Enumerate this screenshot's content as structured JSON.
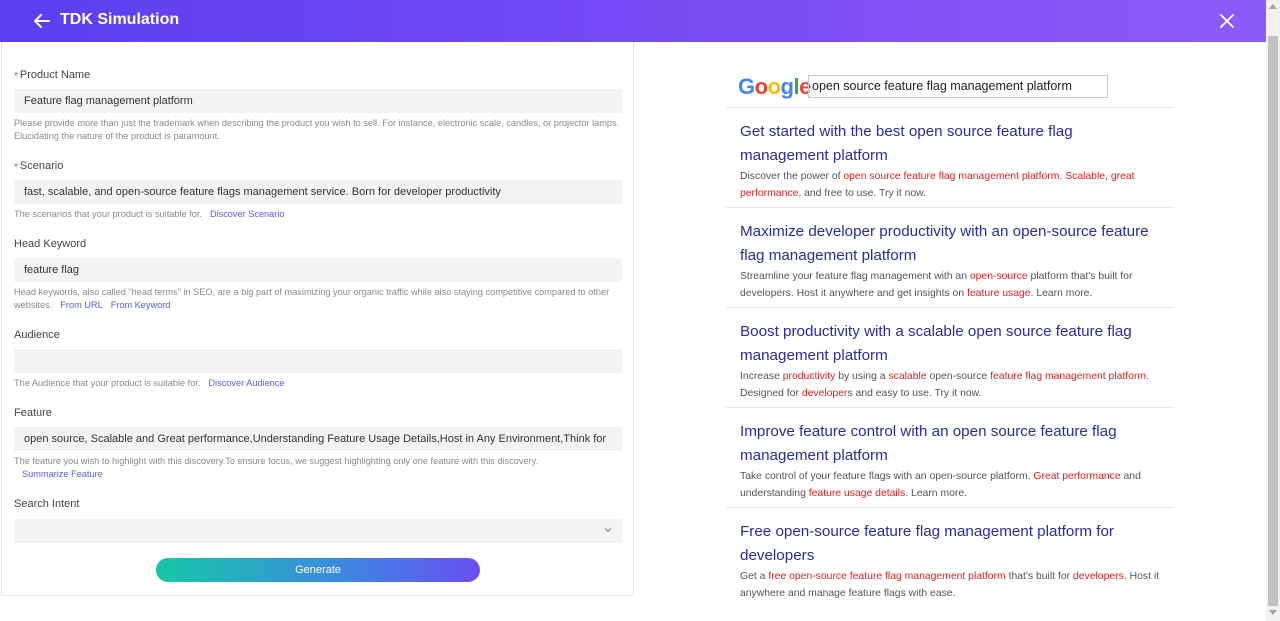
{
  "header": {
    "title": "TDK Simulation",
    "back_icon": "arrow-left-icon",
    "close_icon": "close-icon",
    "background_colors": [
      "#5b3ff0",
      "#8c5cf7"
    ]
  },
  "form": {
    "product_name": {
      "label": "Product Name",
      "required": true,
      "value": "Feature flag management platform",
      "hint": "Please provide more than just the trademark when describing the product you wish to sell. For instance, electronic scale, candles, or projector lamps. Elucidating the nature of the product is paramount."
    },
    "scenario": {
      "label": "Scenario",
      "required": true,
      "value": "fast, scalable, and open-source feature flags management service. Born for developer productivity",
      "hint": "The scenarios that your product is suitable for.",
      "link": "Discover Scenario"
    },
    "head_keyword": {
      "label": "Head Keyword",
      "value": "feature flag",
      "hint": "Head keywords, also called \"head terms\" in SEO, are a big part of maximizing your organic traffic while also staying competitive compared to other websites.",
      "link_url": "From URL",
      "link_keyword": "From Keyword"
    },
    "audience": {
      "label": "Audience",
      "value": "",
      "hint": "The Audience that your product is suitable for.",
      "link": "Discover Audience"
    },
    "feature": {
      "label": "Feature",
      "value": "open source, Scalable and Great performance,Understanding Feature Usage Details,Host in Any Environment,Think for",
      "hint": "The feature you wish to highlight with this discovery.To ensure focus, we suggest highlighting only one feature with this discovery.",
      "link": "Summarize Feature"
    },
    "search_intent": {
      "label": "Search Intent",
      "value": ""
    },
    "generate_label": "Generate",
    "generate_colors": [
      "#16c8a6",
      "#6a4df2"
    ]
  },
  "preview": {
    "logo_text": "Google",
    "search_query": "open source feature flag management platform",
    "results": [
      {
        "title": "Get started with the best open source feature flag management platform",
        "desc": [
          {
            "t": "Discover the power of "
          },
          {
            "t": "open source feature flag management platform",
            "hl": true
          },
          {
            "t": ". "
          },
          {
            "t": "Scalable",
            "hl": true
          },
          {
            "t": ", "
          },
          {
            "t": "great performance",
            "hl": true
          },
          {
            "t": ", and free to use. Try it now."
          }
        ]
      },
      {
        "title": "Maximize developer productivity with an open-source feature flag management platform",
        "desc": [
          {
            "t": "Streamline your feature flag management with an "
          },
          {
            "t": "open-source",
            "hl": true
          },
          {
            "t": " platform that's built for developers. Host it anywhere and get insights on "
          },
          {
            "t": "feature usage",
            "hl": true
          },
          {
            "t": ". Learn more."
          }
        ]
      },
      {
        "title": "Boost productivity with a scalable open source feature flag management platform",
        "desc": [
          {
            "t": "Increase "
          },
          {
            "t": "productivity",
            "hl": true
          },
          {
            "t": " by using a "
          },
          {
            "t": "scalable",
            "hl": true
          },
          {
            "t": " open-source "
          },
          {
            "t": "feature flag management platform",
            "hl": true
          },
          {
            "t": ". Designed for "
          },
          {
            "t": "developer",
            "hl": true
          },
          {
            "t": "s and easy to use. Try it now."
          }
        ]
      },
      {
        "title": "Improve feature control with an open source feature flag management platform",
        "desc": [
          {
            "t": "Take control of your feature flags with an open-source platform. "
          },
          {
            "t": "Great performance",
            "hl": true
          },
          {
            "t": " and understanding "
          },
          {
            "t": "feature usage details",
            "hl": true
          },
          {
            "t": ". Learn more."
          }
        ]
      },
      {
        "title": "Free open-source feature flag management platform for developers",
        "desc": [
          {
            "t": "Get a "
          },
          {
            "t": "free",
            "hl": true
          },
          {
            "t": " "
          },
          {
            "t": "open-source feature flag management platform",
            "hl": true
          },
          {
            "t": " that's built for "
          },
          {
            "t": "developers",
            "hl": true
          },
          {
            "t": ". Host it anywhere and manage feature flags with ease."
          }
        ]
      }
    ],
    "title_color": "#2c2aa6",
    "highlight_color": "#e02020"
  }
}
